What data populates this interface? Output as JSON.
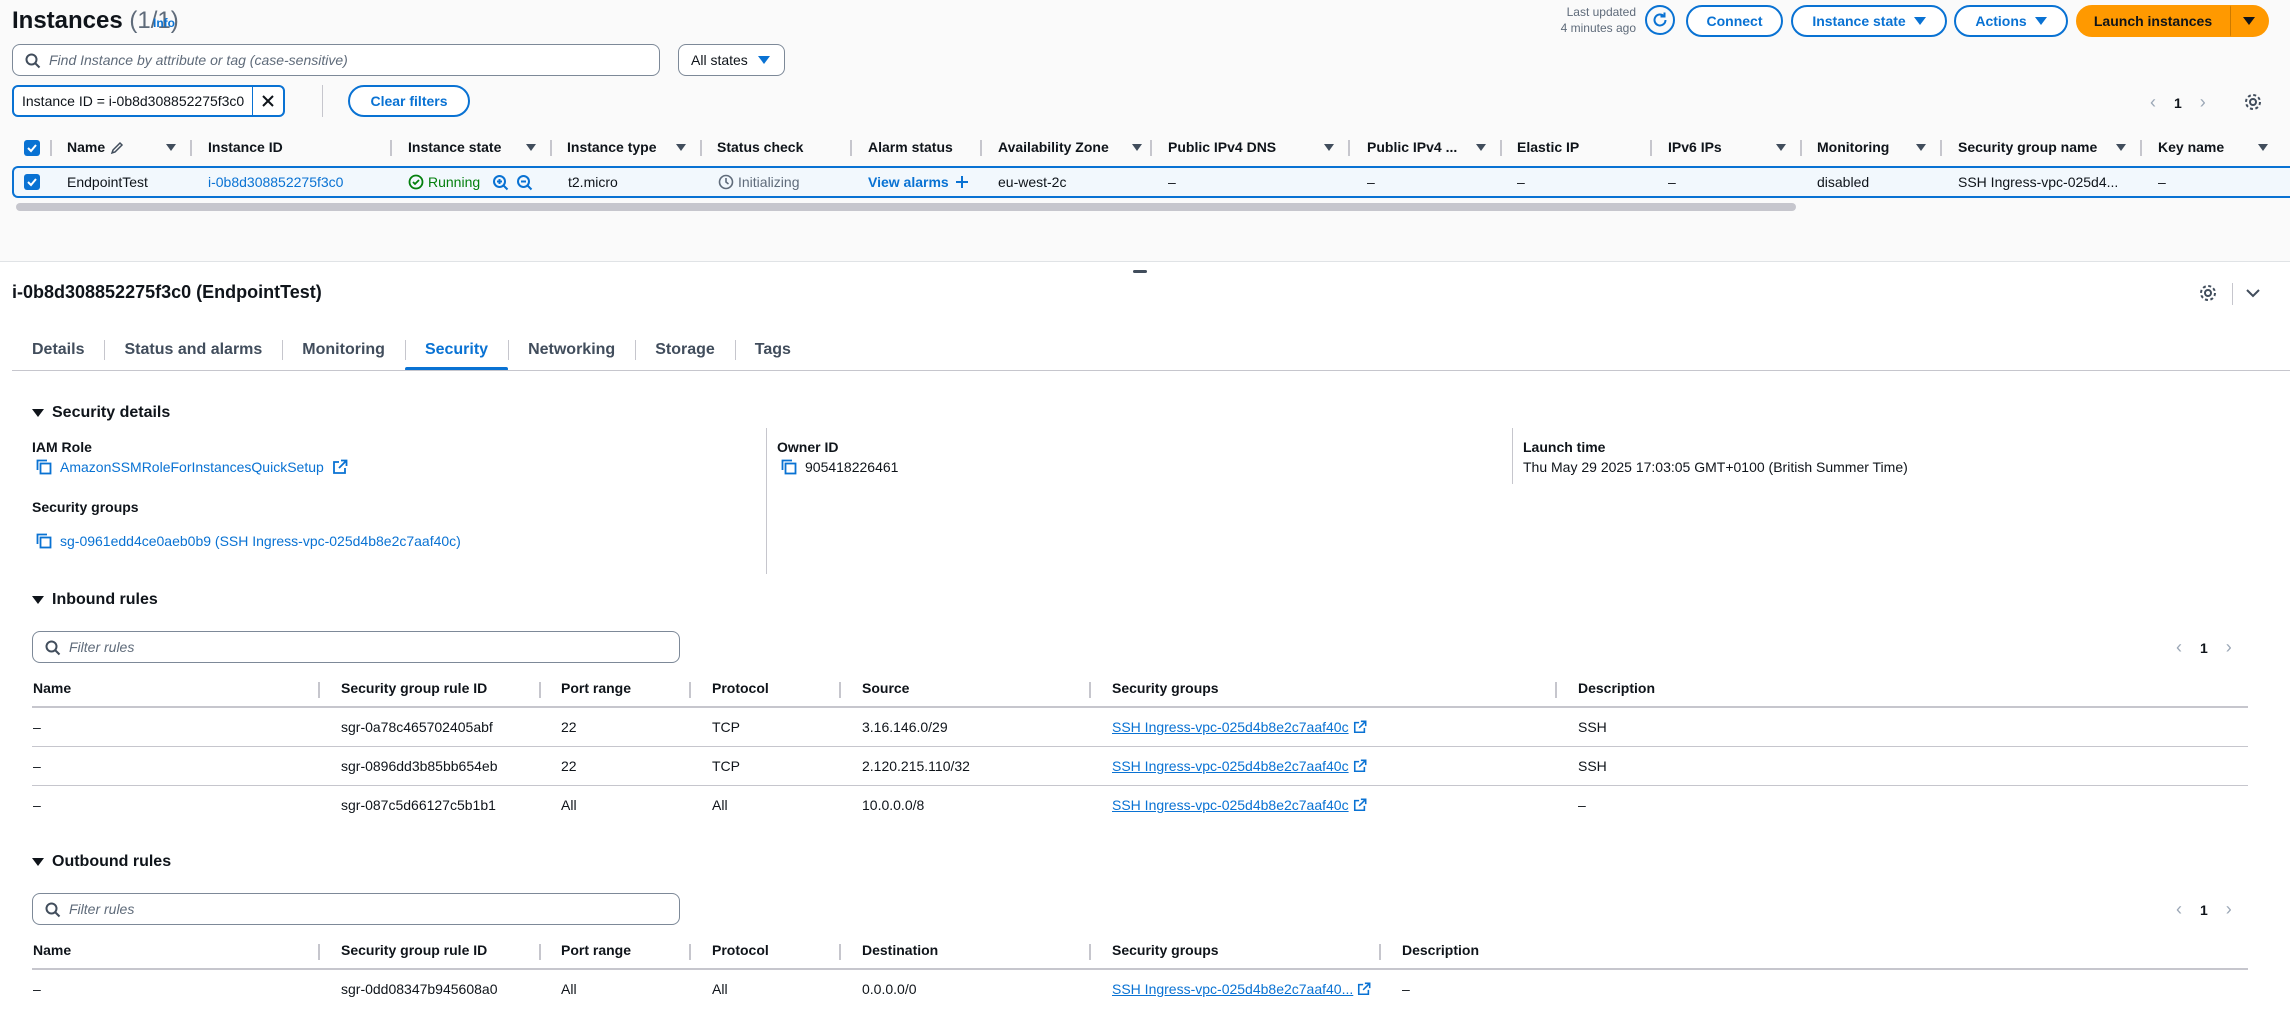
{
  "header": {
    "title": "Instances",
    "count": "(1/1)",
    "info": "Info",
    "last_updated_line1": "Last updated",
    "last_updated_line2": "4 minutes ago",
    "connect": "Connect",
    "instance_state": "Instance state",
    "actions": "Actions",
    "launch": "Launch instances"
  },
  "search": {
    "placeholder": "Find Instance by attribute or tag (case-sensitive)"
  },
  "states_select": "All states",
  "filter_token": "Instance ID = i-0b8d308852275f3c0",
  "clear_filters": "Clear filters",
  "top_pager": {
    "page": "1"
  },
  "instances_table": {
    "columns": [
      "Name",
      "Instance ID",
      "Instance state",
      "Instance type",
      "Status check",
      "Alarm status",
      "Availability Zone",
      "Public IPv4 DNS",
      "Public IPv4 ...",
      "Elastic IP",
      "IPv6 IPs",
      "Monitoring",
      "Security group name",
      "Key name"
    ],
    "row": {
      "name": "EndpointTest",
      "instance_id": "i-0b8d308852275f3c0",
      "state": "Running",
      "type": "t2.micro",
      "status_check": "Initializing",
      "alarm": "View alarms",
      "az": "eu-west-2c",
      "dns": "–",
      "ipv4": "–",
      "eip": "–",
      "ipv6": "–",
      "monitoring": "disabled",
      "sg_name": "SSH Ingress-vpc-025d4...",
      "key": "–"
    }
  },
  "detail": {
    "title": "i-0b8d308852275f3c0 (EndpointTest)",
    "tabs": [
      "Details",
      "Status and alarms",
      "Monitoring",
      "Security",
      "Networking",
      "Storage",
      "Tags"
    ],
    "security_details": {
      "heading": "Security details",
      "iam_role_label": "IAM Role",
      "iam_role_value": "AmazonSSMRoleForInstancesQuickSetup",
      "owner_label": "Owner ID",
      "owner_value": "905418226461",
      "launch_label": "Launch time",
      "launch_value": "Thu May 29 2025 17:03:05 GMT+0100 (British Summer Time)",
      "sg_label": "Security groups",
      "sg_value": "sg-0961edd4ce0aeb0b9 (SSH Ingress-vpc-025d4b8e2c7aaf40c)"
    },
    "inbound": {
      "heading": "Inbound rules",
      "filter_placeholder": "Filter rules",
      "page": "1",
      "columns": [
        "Name",
        "Security group rule ID",
        "Port range",
        "Protocol",
        "Source",
        "Security groups",
        "Description"
      ],
      "rows": [
        {
          "name": "–",
          "rule_id": "sgr-0a78c465702405abf",
          "port": "22",
          "protocol": "TCP",
          "source": "3.16.146.0/29",
          "sg": "SSH Ingress-vpc-025d4b8e2c7aaf40c",
          "desc": "SSH"
        },
        {
          "name": "–",
          "rule_id": "sgr-0896dd3b85bb654eb",
          "port": "22",
          "protocol": "TCP",
          "source": "2.120.215.110/32",
          "sg": "SSH Ingress-vpc-025d4b8e2c7aaf40c",
          "desc": "SSH"
        },
        {
          "name": "–",
          "rule_id": "sgr-087c5d66127c5b1b1",
          "port": "All",
          "protocol": "All",
          "source": "10.0.0.0/8",
          "sg": "SSH Ingress-vpc-025d4b8e2c7aaf40c",
          "desc": "–"
        }
      ]
    },
    "outbound": {
      "heading": "Outbound rules",
      "filter_placeholder": "Filter rules",
      "page": "1",
      "columns": [
        "Name",
        "Security group rule ID",
        "Port range",
        "Protocol",
        "Destination",
        "Security groups",
        "Description"
      ],
      "rows": [
        {
          "name": "–",
          "rule_id": "sgr-0dd08347b945608a0",
          "port": "All",
          "protocol": "All",
          "dest": "0.0.0.0/0",
          "sg": "SSH Ingress-vpc-025d4b8e2c7aaf40...",
          "desc": "–"
        }
      ]
    }
  },
  "colors": {
    "accent": "#0972d3",
    "primary": "#ff9900",
    "success": "#037f0c",
    "selected_row_bg": "#f2f8fd"
  },
  "icons": [
    "refresh-icon",
    "search-icon",
    "close-icon",
    "settings-icon",
    "chevron-down-icon",
    "edit-icon",
    "zoom-in-icon",
    "zoom-out-icon",
    "status-success-icon",
    "status-pending-icon",
    "add-icon",
    "copy-icon",
    "external-link-icon",
    "caret-down-icon",
    "chevron-left-icon",
    "chevron-right-icon",
    "checkbox-checked-icon"
  ]
}
